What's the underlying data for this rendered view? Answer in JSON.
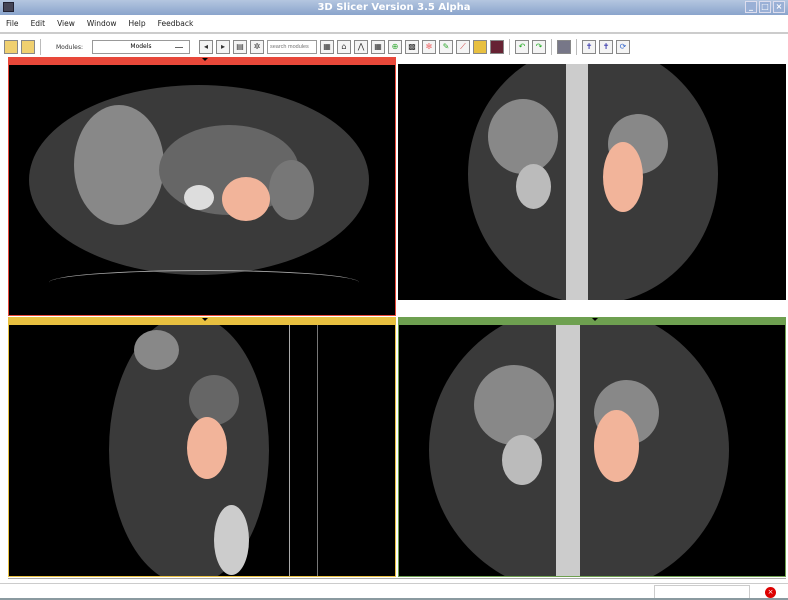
{
  "window": {
    "title": "3D Slicer Version 3.5 Alpha"
  },
  "menu": [
    "File",
    "Edit",
    "View",
    "Window",
    "Help",
    "Feedback"
  ],
  "toolbar": {
    "modules_label": "Modules:",
    "module_selected": "Models",
    "search_placeholder": "search modules"
  },
  "viewers": [
    {
      "name": "red",
      "color": "#e8483a"
    },
    {
      "name": "yellow",
      "color": "#e8c040"
    },
    {
      "name": "green",
      "color": "#6ea050"
    }
  ],
  "segmentation_color": "#f2b49a"
}
